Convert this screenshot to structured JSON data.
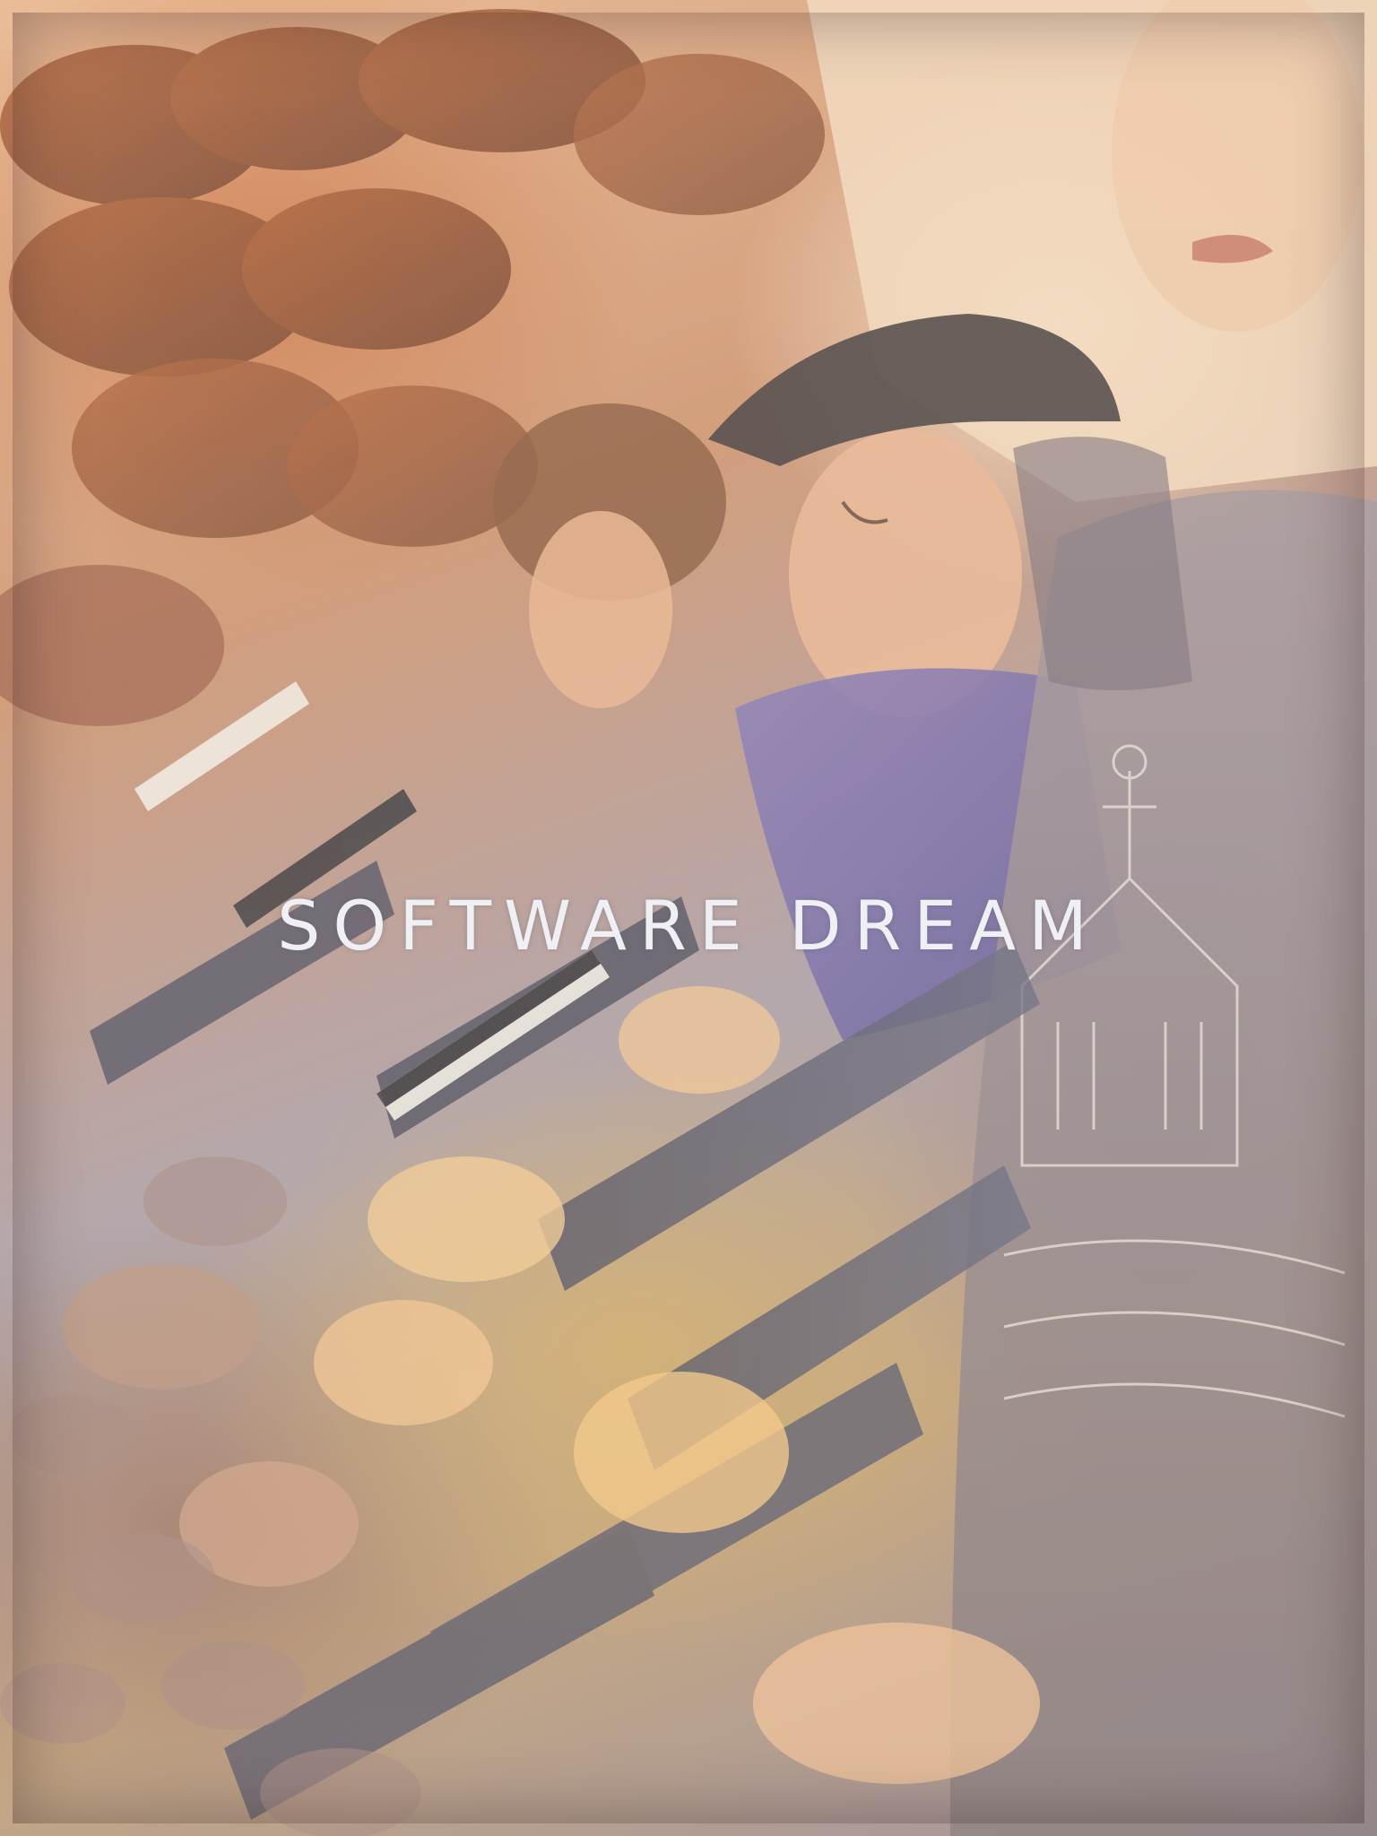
{
  "poster": {
    "title": "SOFTWARE DREAM"
  },
  "colors": {
    "warm_orange": "#c9703e",
    "denim_blue": "#6a63a6",
    "grey_shirt": "#8c8590",
    "skin_tone": "#e8b98a",
    "cap_dark": "#3a3436",
    "title_text": "#eef0f4"
  },
  "scene": {
    "description_items": [
      "repeated-heads",
      "cap-wearer",
      "blue-shirt",
      "grey-shirt",
      "phones",
      "laptop"
    ]
  }
}
